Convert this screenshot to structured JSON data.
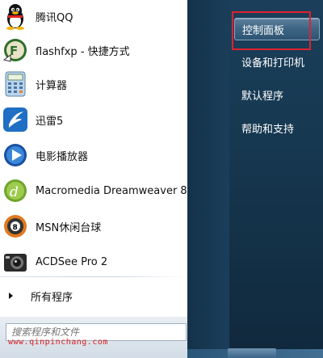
{
  "programs": [
    {
      "label": "腾讯QQ",
      "icon": "qq-penguin-icon"
    },
    {
      "label": "flashfxp - 快捷方式",
      "icon": "flashfxp-icon"
    },
    {
      "label": "计算器",
      "icon": "calculator-icon"
    },
    {
      "label": "迅雷5",
      "icon": "thunder-icon"
    },
    {
      "label": "电影播放器",
      "icon": "media-player-icon"
    },
    {
      "label": "Macromedia Dreamweaver 8",
      "icon": "dreamweaver-icon"
    },
    {
      "label": "MSN休闲台球",
      "icon": "billiards-8ball-icon"
    },
    {
      "label": "ACDSee Pro 2",
      "icon": "acdsee-camera-icon"
    }
  ],
  "all_programs": "所有程序",
  "search": {
    "placeholder": "搜索程序和文件"
  },
  "watermark": "www.qinpinchang.com",
  "right_items": [
    {
      "label": "控制面板",
      "highlighted": true
    },
    {
      "label": "设备和打印机",
      "highlighted": false
    },
    {
      "label": "默认程序",
      "highlighted": false
    },
    {
      "label": "帮助和支持",
      "highlighted": false
    }
  ],
  "colors": {
    "right_panel": "#163850",
    "highlight_box": "#e0222e",
    "watermark": "#d91c1c"
  }
}
